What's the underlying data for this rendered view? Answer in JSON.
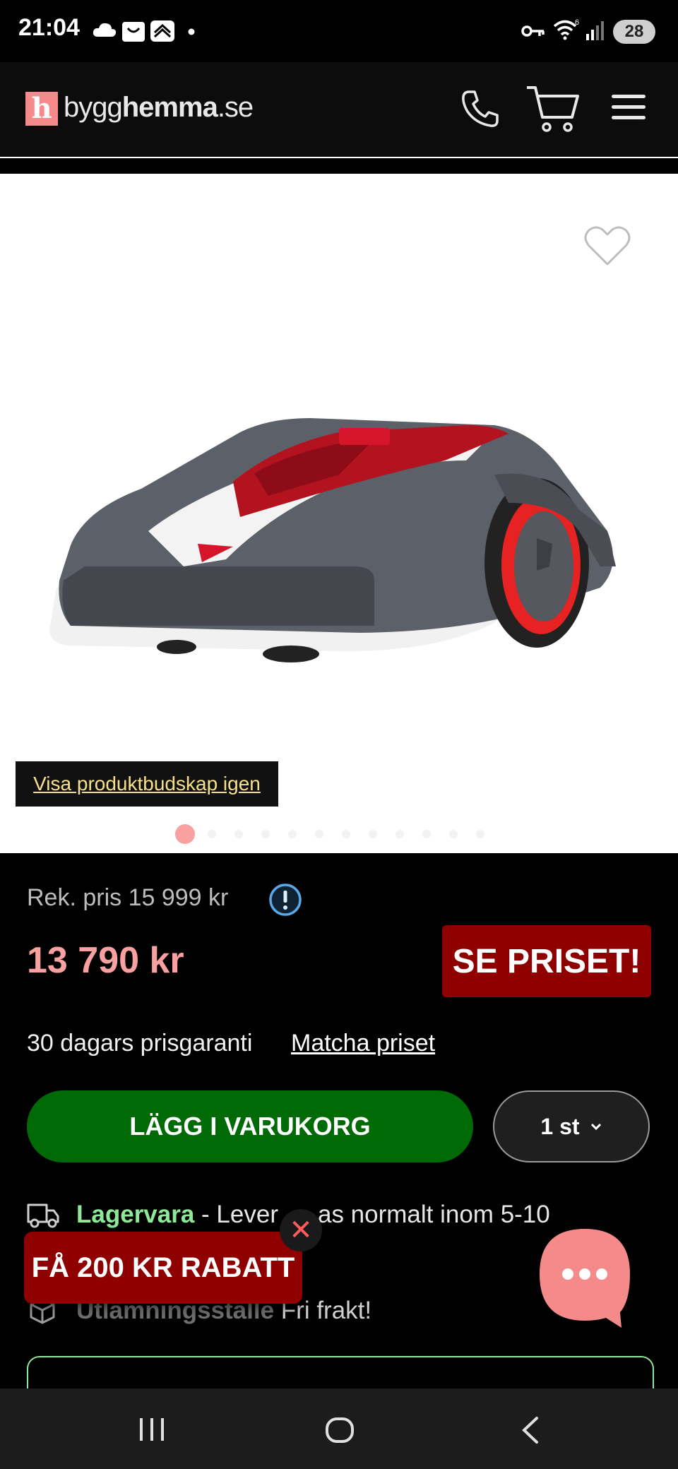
{
  "status_bar": {
    "time": "21:04",
    "battery": "28",
    "icons": [
      "cloud-icon",
      "bag-icon",
      "app-icon",
      "dot-icon",
      "key-icon",
      "wifi-icon",
      "signal-icon",
      "battery-icon"
    ]
  },
  "header": {
    "logo_letter": "h",
    "logo_text_a": "bygg",
    "logo_text_b": "hemma",
    "logo_text_c": ".se",
    "icons": [
      "phone-icon",
      "cart-icon",
      "menu-icon"
    ]
  },
  "product_image": {
    "favorite_icon": "heart-icon",
    "show_message_label": "Visa produktbudskap igen",
    "carousel_dot_count": 12,
    "carousel_active_index": 0
  },
  "price": {
    "recommended": "Rek. pris 15 999 kr",
    "current": "13 790 kr",
    "promo_button": "SE PRISET!",
    "guarantee": "30 dagars prisgaranti",
    "match_link": "Matcha priset"
  },
  "cart": {
    "add_label": "LÄGG I VARUKORG",
    "quantity": "1 st"
  },
  "delivery": {
    "stock_label": "Lagervara",
    "stock_text_a": " - Lever",
    "stock_text_b": "as normalt inom 5-10",
    "pickup_label": "Utlämningsställe",
    "pickup_text": " Fri frakt!"
  },
  "promo": {
    "label": "FÅ 200 KR RABATT",
    "close": "✕"
  },
  "colors": {
    "brand_pink": "#f58a8a",
    "price_pink": "#f9a0a0",
    "promo_red": "#8f0000",
    "cart_green": "#006a06",
    "stock_green": "#8fe89a",
    "link_yellow": "#f6e08a"
  },
  "nav_bar": {
    "icons": [
      "recent-apps-icon",
      "home-icon",
      "back-icon"
    ]
  }
}
